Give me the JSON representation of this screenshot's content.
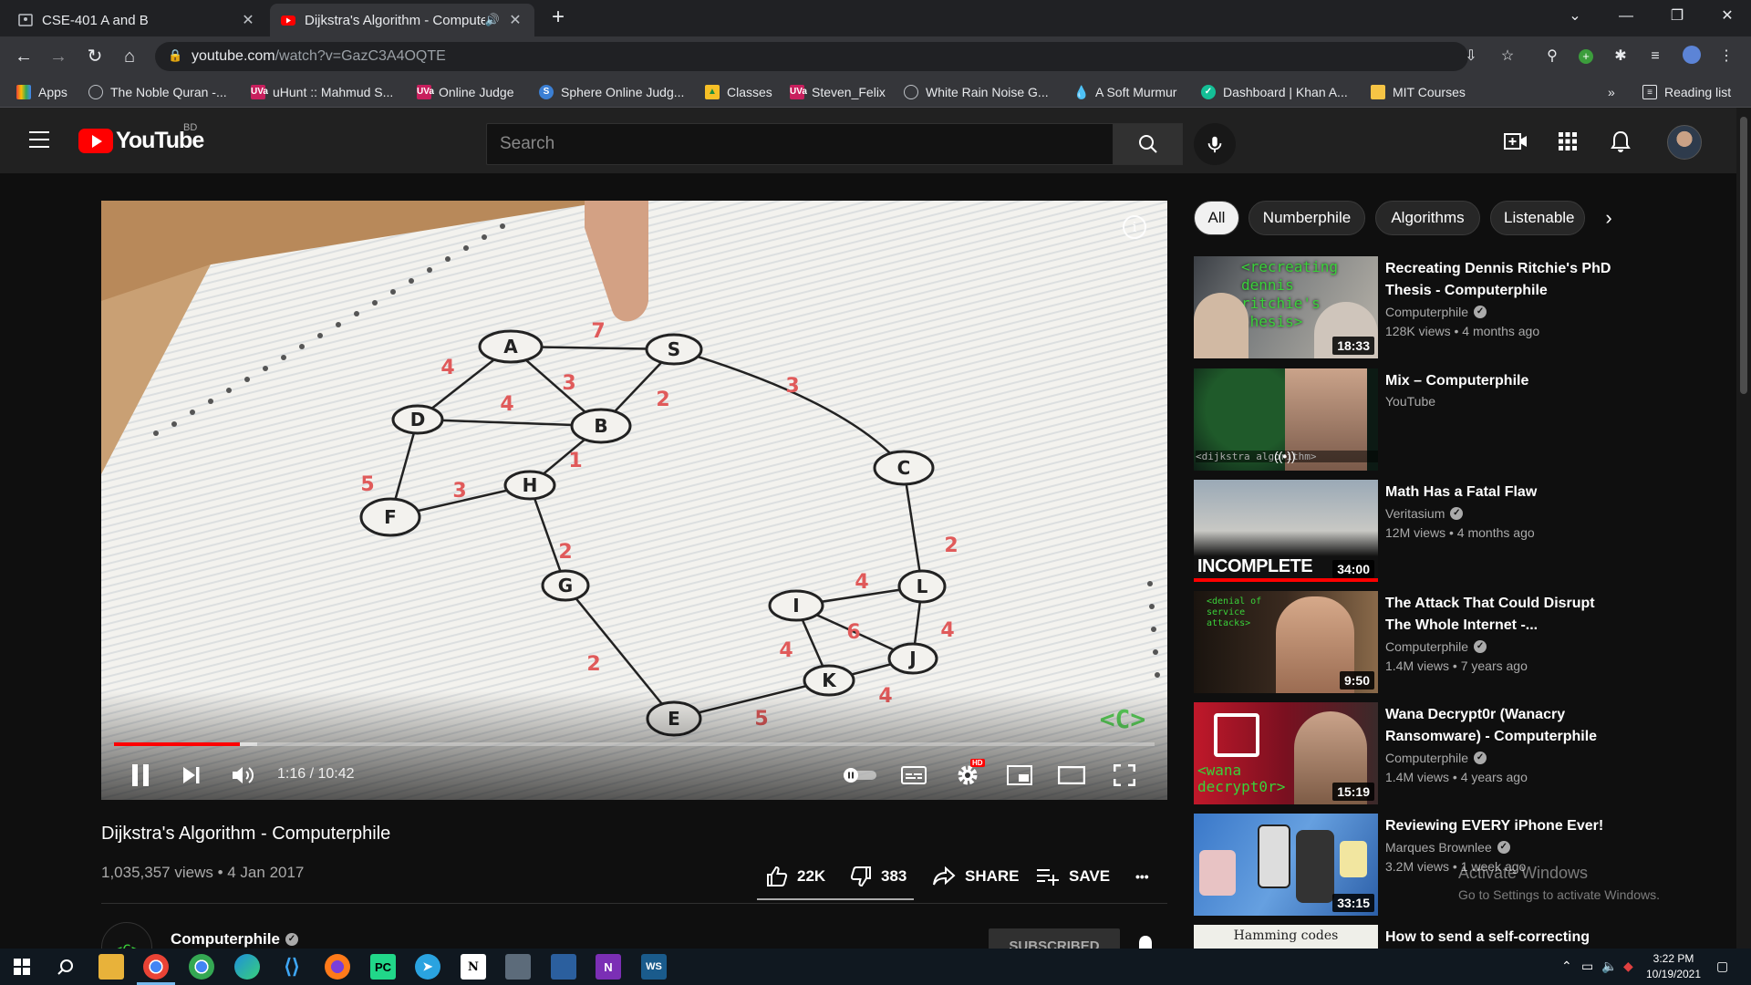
{
  "browser": {
    "tabs": [
      {
        "title": "CSE-401 A and B",
        "active": false
      },
      {
        "title": "Dijkstra's Algorithm - Computerphile",
        "active": true
      }
    ],
    "url_host": "youtube.com",
    "url_path": "/watch?v=GazC3A4OQTE",
    "bookmarks": [
      "Apps",
      "The Noble Quran -...",
      "uHunt :: Mahmud S...",
      "Online Judge",
      "Sphere Online Judg...",
      "Classes",
      "Steven_Felix",
      "White Rain Noise G...",
      "A Soft Murmur",
      "Dashboard | Khan A...",
      "MIT Courses"
    ],
    "reading_list": "Reading list",
    "overflow": "»"
  },
  "masthead": {
    "logo_text": "YouTube",
    "region": "BD",
    "search_placeholder": "Search"
  },
  "player": {
    "time": "1:16 / 10:42",
    "progress_played": 0.121,
    "progress_loaded": 0.138,
    "hd_badge": "HD",
    "info": "i"
  },
  "chips": [
    "All",
    "Numberphile",
    "Algorithms",
    "Listenable"
  ],
  "recommendations": [
    {
      "title": "Recreating Dennis Ritchie's PhD Thesis - Computerphile",
      "channel": "Computerphile",
      "verified": true,
      "meta": "128K views • 4 months ago",
      "duration": "18:33",
      "thumb_text": "<recreating dennis ritchie's thesis>"
    },
    {
      "title": "Mix – Computerphile",
      "channel": "YouTube",
      "verified": false,
      "meta": "",
      "duration": "",
      "thumb_text": "<dijkstra algorithm>"
    },
    {
      "title": "Math Has a Fatal Flaw",
      "channel": "Veritasium",
      "verified": true,
      "meta": "12M views • 4 months ago",
      "duration": "34:00",
      "thumb_text": "INCOMPLETE"
    },
    {
      "title": "The Attack That Could Disrupt The Whole Internet -...",
      "channel": "Computerphile",
      "verified": true,
      "meta": "1.4M views • 7 years ago",
      "duration": "9:50",
      "thumb_text": "<denial of service attacks>"
    },
    {
      "title": "Wana Decrypt0r (Wanacry Ransomware) - Computerphile",
      "channel": "Computerphile",
      "verified": true,
      "meta": "1.4M views • 4 years ago",
      "duration": "15:19",
      "thumb_text": "<wana decrypt0r>"
    },
    {
      "title": "Reviewing EVERY iPhone Ever!",
      "channel": "Marques Brownlee",
      "verified": true,
      "meta": "3.2M views • 1 week ago",
      "duration": "33:15",
      "thumb_text": ""
    },
    {
      "title": "How to send a self-correcting",
      "channel": "",
      "verified": false,
      "meta": "",
      "duration": "",
      "thumb_text": "Hamming codes"
    }
  ],
  "video": {
    "title": "Dijkstra's Algorithm - Computerphile",
    "meta": "1,035,357 views • 4 Jan 2017",
    "likes": "22K",
    "dislikes": "383",
    "share": "SHARE",
    "save": "SAVE",
    "more": "•••",
    "channel": "Computerphile",
    "channel_avatar_text": "<C>",
    "subscribe": "SUBSCRIBED"
  },
  "watermark": {
    "line1": "Activate Windows",
    "line2": "Go to Settings to activate Windows."
  },
  "taskbar": {
    "time": "3:22 PM",
    "date": "10/19/2021"
  },
  "colors": {
    "youtube_red": "#ff0000",
    "bg": "#0f0f0f",
    "masthead": "#212121"
  }
}
